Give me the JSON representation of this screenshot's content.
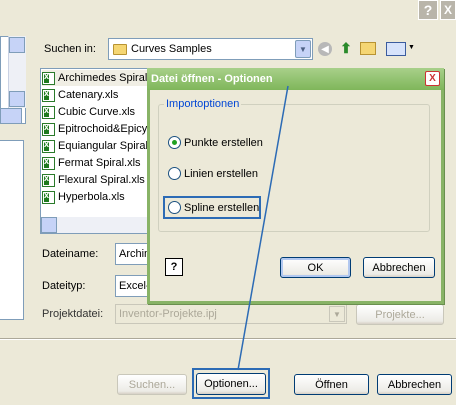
{
  "title_bar": {
    "help_label": "?",
    "close_label": "X"
  },
  "lookin": {
    "label": "Suchen in:",
    "value": "Curves Samples"
  },
  "files": [
    {
      "name": "Archimedes Spiral.xls"
    },
    {
      "name": "Catenary.xls"
    },
    {
      "name": "Cubic Curve.xls"
    },
    {
      "name": "Epitrochoid&Epicycloid.xls"
    },
    {
      "name": "Equiangular Spiral.xls"
    },
    {
      "name": "Fermat Spiral.xls"
    },
    {
      "name": "Flexural Spiral.xls"
    },
    {
      "name": "Hyperbola.xls"
    }
  ],
  "form": {
    "filename_label": "Dateiname:",
    "filename_value": "Archimedes Spiral.xls",
    "filetype_label": "Dateityp:",
    "filetype_value": "Excel-Dateien (*.xls)",
    "project_label": "Projektdatei:",
    "project_value": "Inventor-Projekte.ipj",
    "project_button": "Projekte..."
  },
  "bottom": {
    "search": "Suchen...",
    "options": "Optionen...",
    "open": "Öffnen",
    "cancel": "Abbrechen"
  },
  "dialog": {
    "title": "Datei öffnen - Optionen",
    "close_label": "X",
    "group_label": "Importoptionen",
    "options": [
      {
        "label": "Punkte erstellen",
        "checked": true
      },
      {
        "label": "Linien erstellen",
        "checked": false
      },
      {
        "label": "Spline erstellen",
        "checked": false
      }
    ],
    "help_label": "?",
    "ok": "OK",
    "cancel": "Abbrechen"
  }
}
